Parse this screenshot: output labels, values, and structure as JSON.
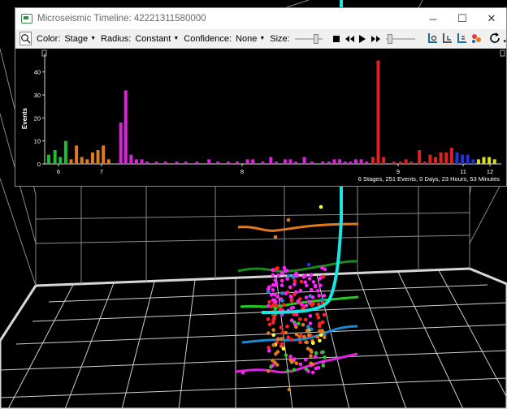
{
  "window": {
    "title": "Microseismic Timeline: 42221311580000",
    "controls": {
      "minimize": "─",
      "maximize": "☐",
      "close": "✕"
    }
  },
  "toolbar": {
    "color_label": "Color:",
    "color_value": "Stage",
    "radius_label": "Radius:",
    "radius_value": "Constant",
    "confidence_label": "Confidence:",
    "confidence_value": "None",
    "size_label": "Size:",
    "size_level": 0.6,
    "playback_level": 0.05,
    "icons": [
      "zoom-window-icon",
      "stop-icon",
      "rewind-icon",
      "play-icon",
      "fast-forward-icon",
      "well-view-1-icon",
      "well-view-2-icon",
      "well-view-3-icon",
      "events-color-icon",
      "reset-icon"
    ]
  },
  "chart_data": {
    "type": "bar",
    "ylabel": "Events",
    "ylim": [
      0,
      48
    ],
    "yticks": [
      0,
      10,
      20,
      30,
      40
    ],
    "xlim": [
      5.75,
      12.35
    ],
    "xticks": [
      "6",
      "7",
      "8",
      "9",
      "11",
      "12"
    ],
    "xtick_values": [
      6,
      7,
      8,
      9,
      11,
      12
    ],
    "bars": [
      {
        "x": 5.84,
        "v": 4,
        "color": "#22bb33"
      },
      {
        "x": 5.98,
        "v": 6,
        "color": "#22bb33"
      },
      {
        "x": 6.1,
        "v": 3,
        "color": "#22bb33"
      },
      {
        "x": 6.22,
        "v": 10,
        "color": "#22bb33"
      },
      {
        "x": 6.34,
        "v": 2,
        "color": "#e07a1e"
      },
      {
        "x": 6.46,
        "v": 8,
        "color": "#e07a1e"
      },
      {
        "x": 6.58,
        "v": 3,
        "color": "#e07a1e"
      },
      {
        "x": 6.7,
        "v": 2,
        "color": "#e07a1e"
      },
      {
        "x": 6.82,
        "v": 5,
        "color": "#e07a1e"
      },
      {
        "x": 6.94,
        "v": 6,
        "color": "#e07a1e"
      },
      {
        "x": 7.06,
        "v": 8,
        "color": "#e07a1e"
      },
      {
        "x": 7.18,
        "v": 2,
        "color": "#e07a1e"
      },
      {
        "x": 7.45,
        "v": 18,
        "color": "#dd22dd"
      },
      {
        "x": 7.56,
        "v": 32,
        "color": "#dd22dd"
      },
      {
        "x": 7.68,
        "v": 4,
        "color": "#dd22dd"
      },
      {
        "x": 7.8,
        "v": 2,
        "color": "#dd22dd"
      },
      {
        "x": 7.92,
        "v": 2,
        "color": "#dd22dd"
      },
      {
        "x": 8.04,
        "v": 1,
        "color": "#dd22dd"
      },
      {
        "x": 8.25,
        "v": 1,
        "color": "#dd22dd"
      },
      {
        "x": 8.45,
        "v": 1,
        "color": "#dd22dd"
      },
      {
        "x": 8.7,
        "v": 1,
        "color": "#dd22dd"
      },
      {
        "x": 8.9,
        "v": 1,
        "color": "#dd22dd"
      },
      {
        "x": 9.15,
        "v": 1,
        "color": "#dd22dd"
      },
      {
        "x": 9.42,
        "v": 2,
        "color": "#dd22dd"
      },
      {
        "x": 9.62,
        "v": 1,
        "color": "#dd22dd"
      },
      {
        "x": 9.85,
        "v": 1,
        "color": "#dd22dd"
      },
      {
        "x": 10.05,
        "v": 1,
        "color": "#dd22dd"
      },
      {
        "x": 10.28,
        "v": 2,
        "color": "#dd22dd"
      },
      {
        "x": 10.4,
        "v": 2,
        "color": "#dd22dd"
      },
      {
        "x": 10.62,
        "v": 1,
        "color": "#dd22dd"
      },
      {
        "x": 10.8,
        "v": 3,
        "color": "#dd22dd"
      },
      {
        "x": 10.92,
        "v": 1,
        "color": "#dd22dd"
      },
      {
        "x": 11.12,
        "v": 2,
        "color": "#dd22dd"
      },
      {
        "x": 11.24,
        "v": 2,
        "color": "#dd22dd"
      },
      {
        "x": 11.36,
        "v": 1,
        "color": "#dd22dd"
      },
      {
        "x": 11.55,
        "v": 3,
        "color": "#dd22dd"
      },
      {
        "x": 11.72,
        "v": 1,
        "color": "#dd22dd"
      },
      {
        "x": 11.96,
        "v": 1,
        "color": "#dd22dd"
      },
      {
        "x": 12.1,
        "v": 1,
        "color": "#dd22dd"
      },
      {
        "x": 12.22,
        "v": 2,
        "color": "#dd22dd"
      },
      {
        "x": 12.34,
        "v": 2,
        "color": "#dd22dd"
      },
      {
        "x": 12.46,
        "v": 1,
        "color": "#dd22dd"
      },
      {
        "x": 12.58,
        "v": 1,
        "color": "#dd22dd"
      },
      {
        "x": 12.7,
        "v": 2,
        "color": "#dd22dd"
      },
      {
        "x": 12.82,
        "v": 2,
        "color": "#dd22dd"
      },
      {
        "x": 12.94,
        "v": 1,
        "color": "#dd22dd"
      },
      {
        "x": 13.08,
        "v": 3,
        "color": "#dd2222"
      },
      {
        "x": 13.2,
        "v": 45,
        "color": "#dd2222"
      },
      {
        "x": 13.32,
        "v": 3,
        "color": "#dd2222"
      },
      {
        "x": 13.55,
        "v": 1,
        "color": "#dd2222"
      },
      {
        "x": 13.7,
        "v": 1,
        "color": "#dd2222"
      },
      {
        "x": 13.82,
        "v": 2,
        "color": "#dd2222"
      },
      {
        "x": 13.94,
        "v": 1,
        "color": "#dd2222"
      },
      {
        "x": 14.12,
        "v": 6,
        "color": "#dd2222"
      },
      {
        "x": 14.24,
        "v": 1,
        "color": "#dd2222"
      },
      {
        "x": 14.36,
        "v": 4,
        "color": "#dd2222"
      },
      {
        "x": 14.48,
        "v": 3,
        "color": "#dd2222"
      },
      {
        "x": 14.6,
        "v": 5,
        "color": "#dd2222"
      },
      {
        "x": 14.72,
        "v": 5,
        "color": "#dd2222"
      },
      {
        "x": 14.84,
        "v": 7,
        "color": "#dd2222"
      },
      {
        "x": 14.96,
        "v": 5,
        "color": "#2233dd"
      },
      {
        "x": 15.08,
        "v": 4,
        "color": "#2233dd"
      },
      {
        "x": 15.2,
        "v": 4,
        "color": "#2233dd"
      },
      {
        "x": 15.32,
        "v": 2,
        "color": "#2233dd"
      },
      {
        "x": 15.44,
        "v": 2,
        "color": "#dddd22"
      },
      {
        "x": 15.56,
        "v": 3,
        "color": "#dddd22"
      },
      {
        "x": 15.68,
        "v": 3,
        "color": "#dddd22"
      },
      {
        "x": 15.8,
        "v": 2,
        "color": "#dddd22"
      }
    ]
  },
  "summary": "6 Stages, 251 Events, 0 Days, 23 Hours, 53 Minutes",
  "scene": {
    "well_color": "#19e3e3",
    "stage_colors": [
      "#e07a1e",
      "#1a8a1a",
      "#22cc22",
      "#1a8ad0",
      "#dd22dd"
    ]
  }
}
